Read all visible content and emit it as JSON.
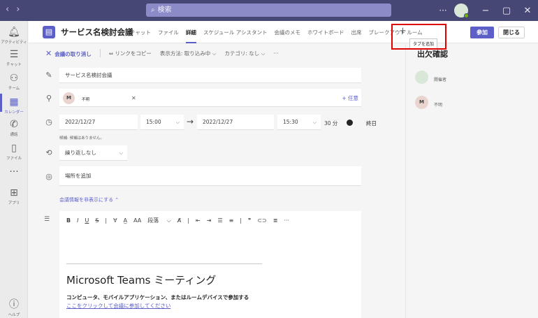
{
  "titlebar": {
    "search_placeholder": "検索",
    "more": "···",
    "minimize": "−",
    "maximize": "▢",
    "close": "✕"
  },
  "rail": {
    "items": [
      {
        "label": "アクティビティ",
        "icon": "bell-icon"
      },
      {
        "label": "チャット",
        "icon": "chat-icon"
      },
      {
        "label": "チーム",
        "icon": "teams-icon"
      },
      {
        "label": "カレンダー",
        "icon": "calendar-icon"
      },
      {
        "label": "通話",
        "icon": "phone-icon"
      },
      {
        "label": "ファイル",
        "icon": "file-icon"
      },
      {
        "label": "",
        "icon": "more-icon"
      },
      {
        "label": "アプリ",
        "icon": "apps-icon"
      }
    ],
    "help_label": "ヘルプ"
  },
  "header": {
    "title": "サービス名検討会議",
    "tabs": [
      "チャット",
      "ファイル",
      "詳細",
      "スケジュール アシスタント",
      "会議のメモ",
      "ホワイトボード",
      "出席",
      "ブレークアウト ルーム"
    ],
    "active_tab": "詳細",
    "add_tab_tooltip": "タブを追加",
    "join_label": "参加",
    "close_label": "閉じる"
  },
  "toolbar": {
    "cancel": "会議の取り消し",
    "copy_link": "リンクをコピー",
    "show_as": "表示方法: 取り込み中",
    "category": "カテゴリ: なし",
    "more": "···"
  },
  "form": {
    "title_value": "サービス名検討会議",
    "attendee": {
      "initial": "M",
      "name": "不明"
    },
    "optional_label": "+ 任意",
    "start_date": "2022/12/27",
    "start_time": "15:00",
    "end_date": "2022/12/27",
    "end_time": "15:30",
    "duration": "30 分",
    "all_day_label": "終日",
    "all_day_on": false,
    "suggestion": "候補: 候補はありません。",
    "repeat": "繰り返しなし",
    "location_placeholder": "場所を追加",
    "hide_info": "会議情報を非表示にする"
  },
  "editor": {
    "paragraph_label": "段落",
    "heading": "Microsoft Teams ミーティング",
    "join_description": "コンピュータ、モバイルアプリケーション、またはルームデバイスで参加する",
    "join_link": "ここをクリックして会議に参加してください"
  },
  "attendance": {
    "title": "出欠確認",
    "organizer_label": "開催者",
    "attendee_initial": "M",
    "attendee_label": "不明"
  },
  "colors": {
    "brand": "#5b5fc7",
    "titlebar": "#464775",
    "highlight": "#e00000"
  }
}
